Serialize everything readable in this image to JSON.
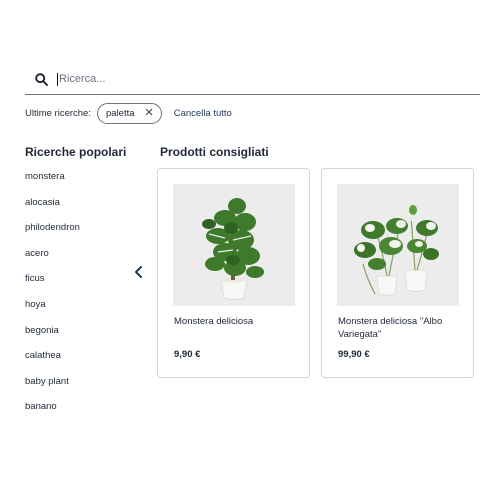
{
  "search": {
    "placeholder": "Ricerca..."
  },
  "recent": {
    "label": "Ultime ricerche:",
    "chips": [
      "paletta"
    ],
    "clear_label": "Cancella tutto"
  },
  "popular": {
    "title": "Ricerche popolari",
    "items": [
      "monstera",
      "alocasia",
      "philodendron",
      "acero",
      "ficus",
      "hoya",
      "begonia",
      "calathea",
      "baby plant",
      "banano"
    ]
  },
  "products": {
    "title": "Prodotti consigliati",
    "items": [
      {
        "name": "Monstera deliciosa",
        "price": "9,90 €"
      },
      {
        "name": "Monstera deliciosa \"Albo Variegata\"",
        "price": "99,90 €"
      }
    ]
  },
  "icons": {
    "search": "search-icon",
    "close": "close-icon",
    "prev": "chevron-left-icon"
  }
}
